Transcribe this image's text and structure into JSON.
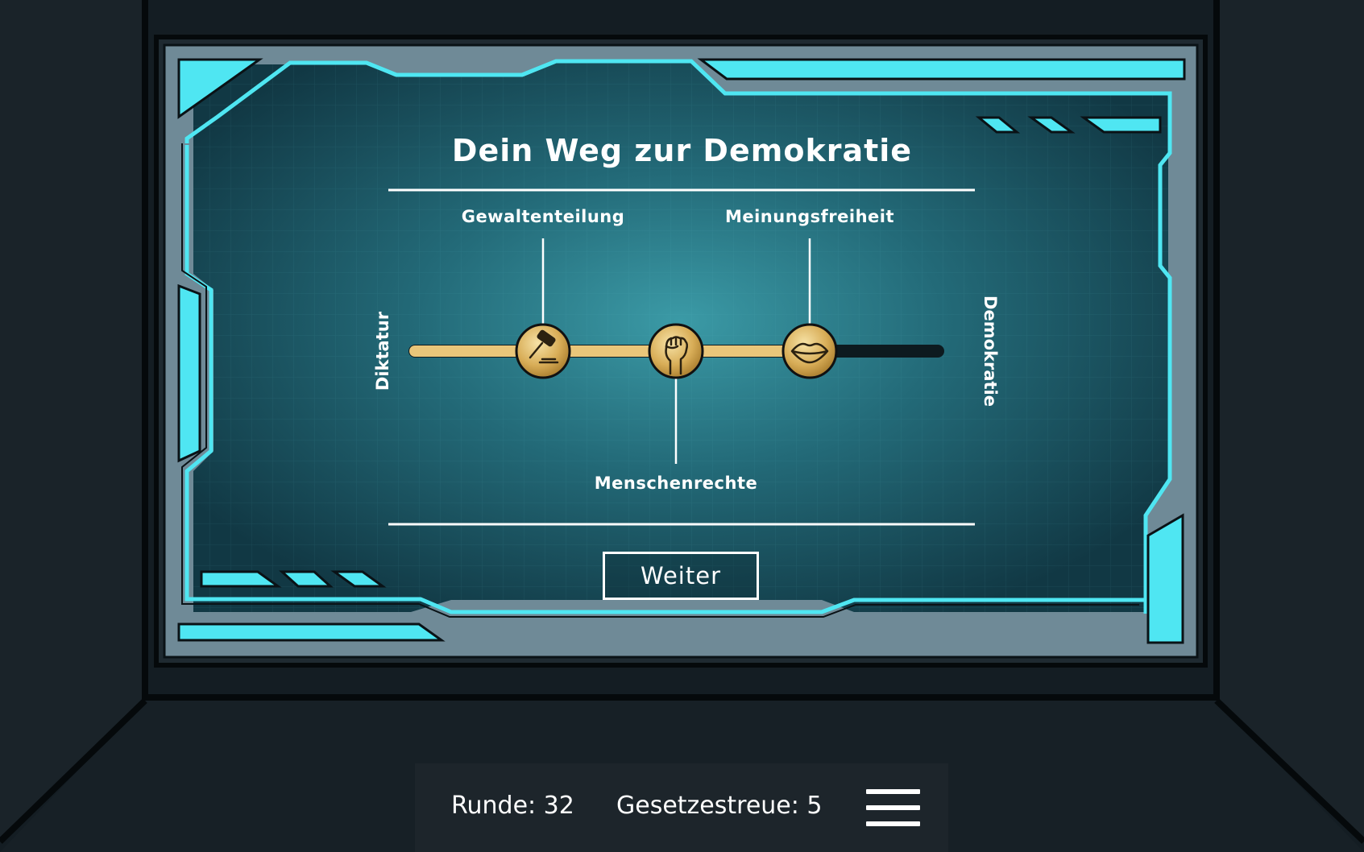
{
  "screen": {
    "title": "Dein Weg zur Demokratie",
    "left_pole": "Diktatur",
    "right_pole": "Demokratie",
    "progress_fraction": 0.75,
    "milestones": [
      {
        "label": "Gewaltenteilung",
        "icon": "gavel-icon",
        "label_position": "above"
      },
      {
        "label": "Menschenrechte",
        "icon": "raised-fist-icon",
        "label_position": "below"
      },
      {
        "label": "Meinungsfreiheit",
        "icon": "lips-icon",
        "label_position": "above"
      }
    ],
    "continue_label": "Weiter"
  },
  "hud": {
    "round_text": "Runde: 32",
    "law_text": "Gesetzestreue: 5",
    "menu_icon": "hamburger-menu-icon"
  },
  "colors": {
    "accent_cyan": "#4fe6f2",
    "progress_gold": "#e9c67a",
    "track_dark": "#0d1a1f",
    "background": "#141d23"
  }
}
